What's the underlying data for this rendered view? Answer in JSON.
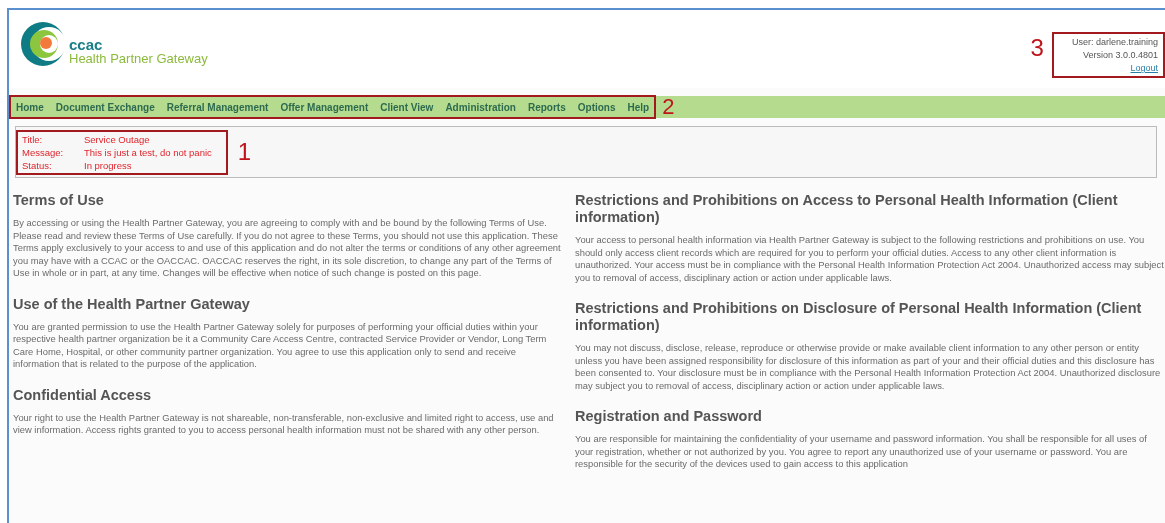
{
  "header": {
    "logo_acronym": "ccac",
    "logo_name": "Health Partner Gateway"
  },
  "user_panel": {
    "user": "User: darlene.training",
    "version": "Version 3.0.0.4801",
    "logout": "Logout",
    "callout": "3"
  },
  "nav": {
    "items": [
      "Home",
      "Document Exchange",
      "Referral Management",
      "Offer Management",
      "Client View",
      "Administration",
      "Reports",
      "Options",
      "Help"
    ],
    "callout": "2"
  },
  "alert": {
    "rows": [
      {
        "label": "Title:",
        "value": "Service Outage"
      },
      {
        "label": "Message:",
        "value": "This is just a test, do not panic"
      },
      {
        "label": "Status:",
        "value": "In progress"
      }
    ],
    "callout": "1"
  },
  "columns": [
    [
      {
        "heading": "Terms of Use",
        "body": "By accessing or using the Health Partner Gateway, you are agreeing to comply with and be bound by the following Terms of Use. Please read and review these Terms of Use carefully. If you do not agree to these Terms, you should not use this application. These Terms apply exclusively to your access to and use of this application and do not alter the terms or conditions of any other agreement you may have with a CCAC or the OACCAC. OACCAC reserves the right, in its sole discretion, to change any part of the Terms of Use in whole or in part, at any time. Changes will be effective when notice of such change is posted on this page."
      },
      {
        "heading": "Use of the Health Partner Gateway",
        "body": "You are granted permission to use the Health Partner Gateway solely for purposes of performing your official duties within your respective health partner organization be it a Community Care Access Centre, contracted Service Provider or Vendor, Long Term Care Home, Hospital, or other community partner organization. You agree to use this application only to send and receive information that is related to the purpose of the application."
      },
      {
        "heading": "Confidential Access",
        "body": "Your right to use the Health Partner Gateway is not shareable, non-transferable, non-exclusive and limited right to access, use and view information. Access rights granted to you to access personal health information must not be shared with any other person."
      }
    ],
    [
      {
        "heading": "Restrictions and Prohibitions on Access to Personal Health Information (Client information)",
        "body": "Your access to personal health information via Health Partner Gateway is subject to the following restrictions and prohibitions on use. You should only access client records which are required for you to perform your official duties. Access to any other client information is unauthorized. Your access must be in compliance with the Personal Health Information Protection Act 2004. Unauthorized access may subject you to removal of access, disciplinary action or action under applicable laws."
      },
      {
        "heading": "Restrictions and Prohibitions on Disclosure of Personal Health Information (Client information)",
        "body": "You may not discuss, disclose, release, reproduce or otherwise provide or make available client information to any other person or entity unless you have been assigned responsibility for disclosure of this information as part of your and their official duties and this disclosure has been consented to. Your disclosure must be in compliance with the Personal Health Information Protection Act 2004. Unauthorized disclosure may subject you to removal of access, disciplinary action or action under applicable laws."
      },
      {
        "heading": "Registration and Password",
        "body": "You are responsible for maintaining the confidentiality of your username and password information. You shall be responsible for all uses of your registration, whether or not authorized by you. You agree to report any unauthorized use of your username or password. You are responsible for the security of the devices used to gain access to this application"
      }
    ]
  ]
}
